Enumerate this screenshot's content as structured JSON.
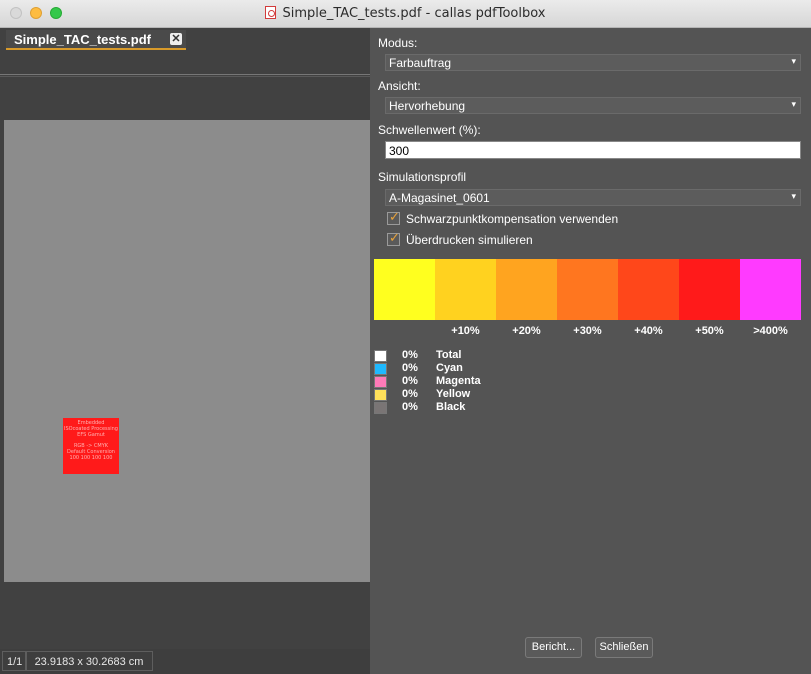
{
  "window": {
    "title": "Simple_TAC_tests.pdf - callas pdfToolbox"
  },
  "document": {
    "tab_label": "Simple_TAC_tests.pdf",
    "tab_close": "✕",
    "page_content_lines": [
      "Embedded",
      "ISOcoated Processing",
      "EFS Gamut",
      "",
      "RGB -> CMYK",
      "Default Conversion",
      "100 100 100 100"
    ],
    "status_page": "1/1",
    "status_size": "23.9183 x 30.2683 cm"
  },
  "panel": {
    "modus_label": "Modus:",
    "modus_value": "Farbauftrag",
    "ansicht_label": "Ansicht:",
    "ansicht_value": "Hervorhebung",
    "schwellenwert_label": "Schwellenwert (%):",
    "schwellenwert_value": "300",
    "simulationsprofil_label": "Simulationsprofil",
    "simulationsprofil_value": "A-Magasinet_0601",
    "check_black_point": "Schwarzpunktkompensation verwenden",
    "check_overprint": "Überdrucken simulieren",
    "scale": [
      {
        "color": "#ffff1f",
        "label": ""
      },
      {
        "color": "#ffd21f",
        "label": "+10%"
      },
      {
        "color": "#ffa41f",
        "label": "+20%"
      },
      {
        "color": "#ff761f",
        "label": "+30%"
      },
      {
        "color": "#ff471a",
        "label": "+40%"
      },
      {
        "color": "#ff1a1a",
        "label": "+50%"
      },
      {
        "color": "#ff3aff",
        "label": ">400%"
      }
    ],
    "legend": [
      {
        "color": "#ffffff",
        "pct": "0%",
        "name": "Total"
      },
      {
        "color": "#1fb9ff",
        "pct": "0%",
        "name": "Cyan"
      },
      {
        "color": "#ff7ab8",
        "pct": "0%",
        "name": "Magenta"
      },
      {
        "color": "#ffe05a",
        "pct": "0%",
        "name": "Yellow"
      },
      {
        "color": "#7a7575",
        "pct": "0%",
        "name": "Black"
      }
    ],
    "report_button": "Bericht...",
    "close_button": "Schließen"
  }
}
